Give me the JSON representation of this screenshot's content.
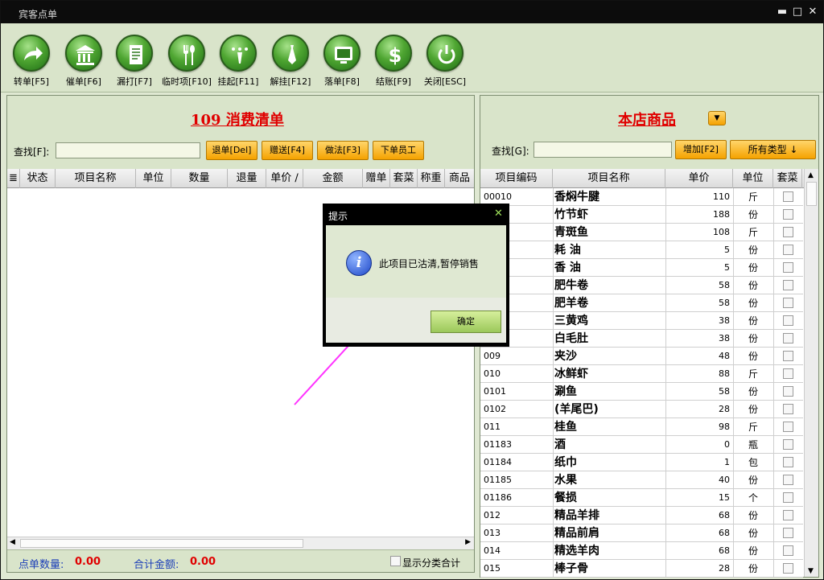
{
  "window": {
    "title": "宾客点单",
    "minimize_glyph": "▬",
    "maximize_glyph": "□",
    "close_glyph": "✕"
  },
  "toolbar": {
    "buttons": [
      {
        "label": "转单[F5]",
        "icon": "redirect-arrow-icon"
      },
      {
        "label": "催单[F6]",
        "icon": "bank-building-icon"
      },
      {
        "label": "漏打[F7]",
        "icon": "document-icon"
      },
      {
        "label": "临时项[F10]",
        "icon": "fork-spoon-icon"
      },
      {
        "label": "挂起[F11]",
        "icon": "hanger-icon"
      },
      {
        "label": "解挂[F12]",
        "icon": "tie-icon"
      },
      {
        "label": "落单[F8]",
        "icon": "monitor-icon"
      },
      {
        "label": "结账[F9]",
        "icon": "dollar-icon"
      },
      {
        "label": "关闭[ESC]",
        "icon": "power-icon"
      }
    ]
  },
  "order_panel": {
    "title": "109  消费清单",
    "search_label": "查找[F]:",
    "search_value": "",
    "buttons": [
      "退单[Del]",
      "赠送[F4]",
      "做法[F3]",
      "下单员工"
    ],
    "columns": [
      "≣",
      "状态",
      "项目名称",
      "单位",
      "数量",
      "退量",
      "单价 ∕",
      "金额",
      "赠单",
      "套菜",
      "称重",
      "商品"
    ],
    "footer": {
      "count_label": "点单数量:",
      "count_value": "0.00",
      "amount_label": "合计金额:",
      "amount_value": "0.00",
      "show_category_label": "显示分类合计"
    }
  },
  "goods_panel": {
    "title": "本店商品",
    "search_label": "查找[G]:",
    "search_value": "",
    "add_button": "增加[F2]",
    "type_button": "所有类型 ↓",
    "columns": [
      "项目编码",
      "项目名称",
      "单价",
      "单位",
      "套菜"
    ],
    "rows": [
      {
        "code": "00010",
        "name": "香焖牛腱",
        "price": "110",
        "unit": "斤"
      },
      {
        "code": "",
        "name": "竹节虾",
        "price": "188",
        "unit": "份"
      },
      {
        "code": "",
        "name": "青斑鱼",
        "price": "108",
        "unit": "斤"
      },
      {
        "code": "",
        "name": "耗 油",
        "price": "5",
        "unit": "份"
      },
      {
        "code": "",
        "name": "香 油",
        "price": "5",
        "unit": "份"
      },
      {
        "code": "",
        "name": "肥牛卷",
        "price": "58",
        "unit": "份"
      },
      {
        "code": "",
        "name": "肥羊卷",
        "price": "58",
        "unit": "份"
      },
      {
        "code": "",
        "name": "三黄鸡",
        "price": "38",
        "unit": "份"
      },
      {
        "code": "",
        "name": "白毛肚",
        "price": "38",
        "unit": "份"
      },
      {
        "code": "009",
        "name": "夹沙",
        "price": "48",
        "unit": "份"
      },
      {
        "code": "010",
        "name": "冰鲜虾",
        "price": "88",
        "unit": "斤"
      },
      {
        "code": "0101",
        "name": "涮鱼",
        "price": "58",
        "unit": "份"
      },
      {
        "code": "0102",
        "name": "(羊尾巴)",
        "price": "28",
        "unit": "份"
      },
      {
        "code": "011",
        "name": "桂鱼",
        "price": "98",
        "unit": "斤"
      },
      {
        "code": "01183",
        "name": "酒",
        "price": "0",
        "unit": "瓶"
      },
      {
        "code": "01184",
        "name": "纸巾",
        "price": "1",
        "unit": "包"
      },
      {
        "code": "01185",
        "name": "水果",
        "price": "40",
        "unit": "份"
      },
      {
        "code": "01186",
        "name": "餐损",
        "price": "15",
        "unit": "个"
      },
      {
        "code": "012",
        "name": "精品羊排",
        "price": "68",
        "unit": "份"
      },
      {
        "code": "013",
        "name": "精品前肩",
        "price": "68",
        "unit": "份"
      },
      {
        "code": "014",
        "name": "精选羊肉",
        "price": "68",
        "unit": "份"
      },
      {
        "code": "015",
        "name": "棒子骨",
        "price": "28",
        "unit": "份"
      }
    ]
  },
  "dialog": {
    "title": "提示",
    "close_glyph": "✕",
    "message": "此项目已沽清,暂停销售",
    "ok_label": "确定",
    "info_glyph": "i"
  },
  "colors": {
    "accent_red": "#e00000",
    "panel_green": "#d9e4ca",
    "button_orange": "#f5a200",
    "annotation_arrow": "#ff33ff"
  }
}
